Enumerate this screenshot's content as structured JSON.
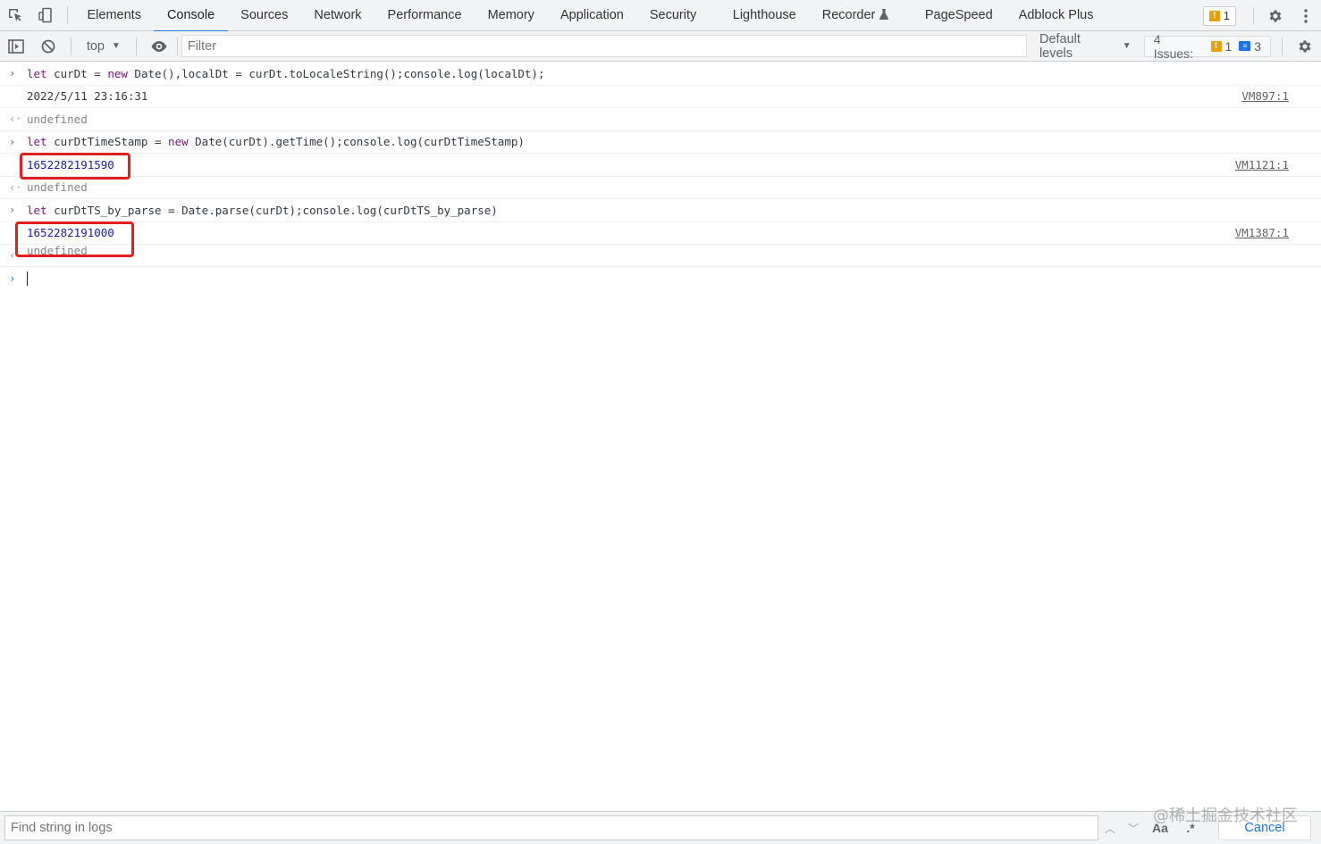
{
  "tabs": [
    "Elements",
    "Console",
    "Sources",
    "Network",
    "Performance",
    "Memory",
    "Application",
    "Security",
    "Lighthouse",
    "Recorder",
    "PageSpeed",
    "Adblock Plus"
  ],
  "active_tab": "Console",
  "tab_badge": {
    "count": "1"
  },
  "toolbar": {
    "context": "top",
    "filter_placeholder": "Filter",
    "levels": "Default levels",
    "issues_label": "4 Issues:",
    "issues_warn": "1",
    "issues_info": "3"
  },
  "console": {
    "cmd1_kw1": "let",
    "cmd1_a": " curDt = ",
    "cmd1_kw2": "new",
    "cmd1_b": " Date(),localDt = curDt.toLocaleString();console.log(localDt);",
    "out1": "2022/5/11 23:16:31",
    "out1_src": "VM897:1",
    "undef": "undefined",
    "cmd2_kw1": "let",
    "cmd2_a": " curDtTimeStamp = ",
    "cmd2_kw2": "new",
    "cmd2_b": " Date(curDt).getTime();console.log(curDtTimeStamp)",
    "out2": "1652282191590",
    "out2_src": "VM1121:1",
    "cmd3_kw1": "let",
    "cmd3_a": " curDtTS_by_parse = Date.parse(curDt);console.log(curDtTS_by_parse)",
    "out3": "1652282191000",
    "out3_src": "VM1387:1"
  },
  "findbar": {
    "placeholder": "Find string in logs",
    "case_label": "Aa",
    "regex_label": ".*",
    "cancel": "Cancel"
  },
  "watermark": "@稀土掘金技术社区"
}
